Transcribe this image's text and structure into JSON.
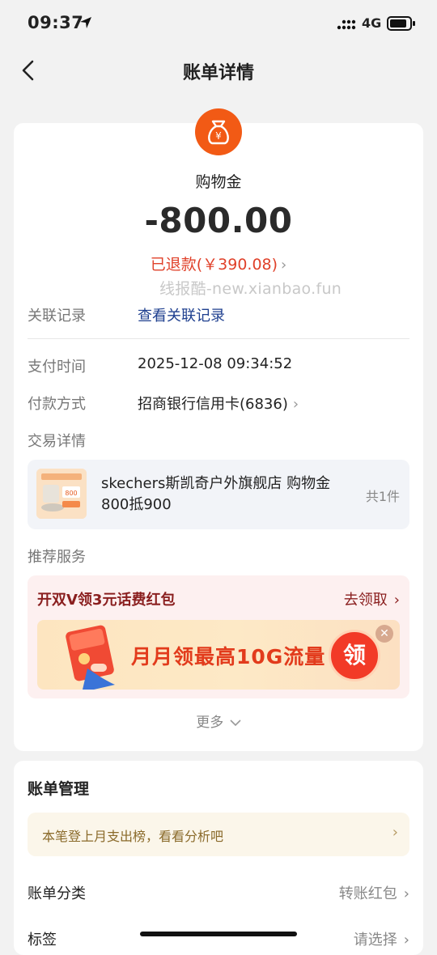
{
  "status_bar": {
    "time": "09:37",
    "network": "4G"
  },
  "nav": {
    "title": "账单详情"
  },
  "bill": {
    "merchant": "购物金",
    "amount": "-800.00",
    "refund_text": "已退款(￥390.08)",
    "watermark": "线报酷-new.xianbao.fun"
  },
  "rows": {
    "related_label": "关联记录",
    "related_value": "查看关联记录",
    "pay_time_label": "支付时间",
    "pay_time_value": "2025-12-08 09:34:52",
    "pay_method_label": "付款方式",
    "pay_method_value": "招商银行信用卡(6836)",
    "trade_label": "交易详情"
  },
  "trade": {
    "title": "skechers斯凯奇户外旗舰店 购物金800抵900",
    "count": "共1件"
  },
  "recommend": {
    "section_label": "推荐服务",
    "promo_title": "开双V领3元话费红包",
    "promo_action": "去领取",
    "banner_text": "月月领最高10G流量",
    "banner_badge": "领",
    "more": "更多"
  },
  "manage": {
    "title": "账单管理",
    "analysis_text": "本笔登上月支出榜，看看分析吧",
    "category_label": "账单分类",
    "category_value": "转账红包",
    "tag_label": "标签",
    "tag_value": "请选择"
  },
  "colors": {
    "accent": "#f25a15",
    "refund": "#e0412a",
    "link": "#1e3f8f",
    "promo": "#8a1f1f"
  }
}
